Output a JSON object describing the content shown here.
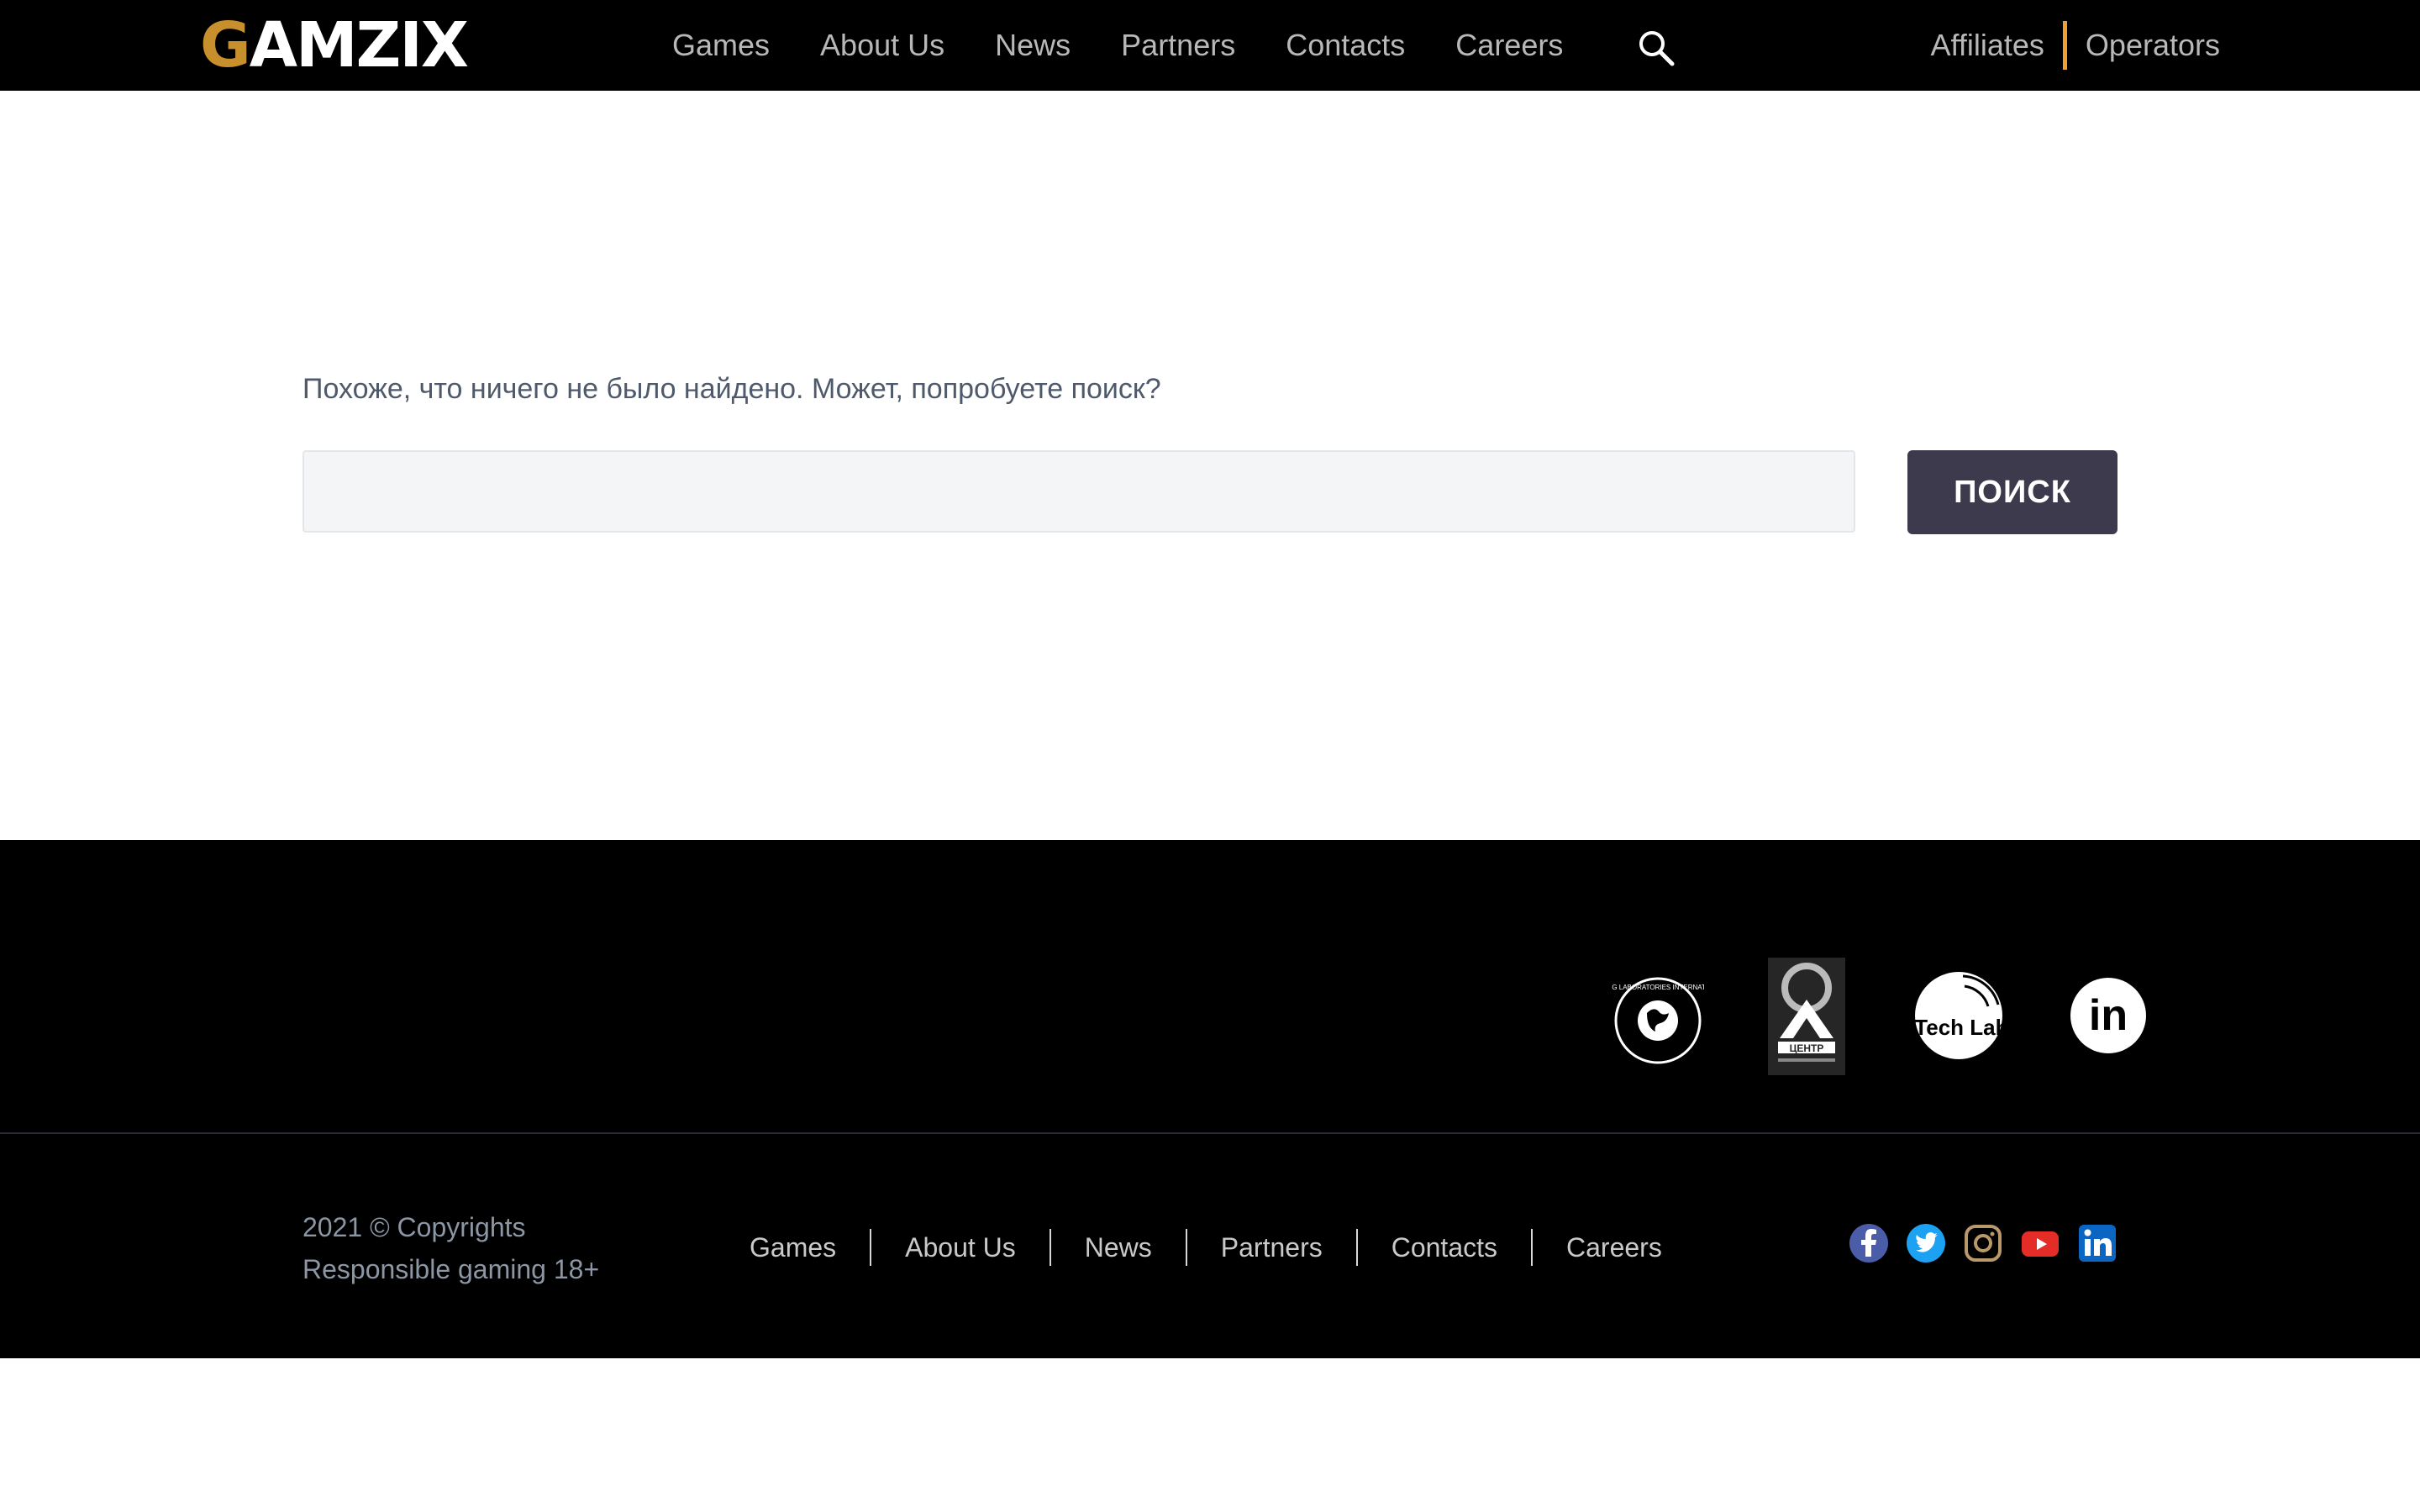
{
  "header": {
    "logo_text": "GAMZIX",
    "nav": [
      "Games",
      "About Us",
      "News",
      "Partners",
      "Contacts",
      "Careers"
    ],
    "side_links": [
      "Affiliates",
      "Operators"
    ],
    "accent_color": "#f0a030"
  },
  "main": {
    "message": "Похоже, что ничего не было найдено. Может, попробуете поиск?",
    "search_value": "",
    "search_button": "ПОИСК"
  },
  "footer": {
    "badges": [
      "gli-icon",
      "business-center-icon",
      "itech-labs-icon",
      "linkedin-icon"
    ],
    "badge_labels": {
      "gli": "GAMING LABORATORIES INTERNATIONAL",
      "center": "ЦЕНТР",
      "itech": "iTech Labs",
      "in": "in"
    },
    "copyright_line1": "2021 © Copyrights",
    "copyright_line2": "Responsible gaming 18+",
    "nav": [
      "Games",
      "About Us",
      "News",
      "Partners",
      "Contacts",
      "Careers"
    ],
    "social": [
      "facebook-icon",
      "twitter-icon",
      "instagram-icon",
      "youtube-icon",
      "linkedin-icon"
    ]
  }
}
